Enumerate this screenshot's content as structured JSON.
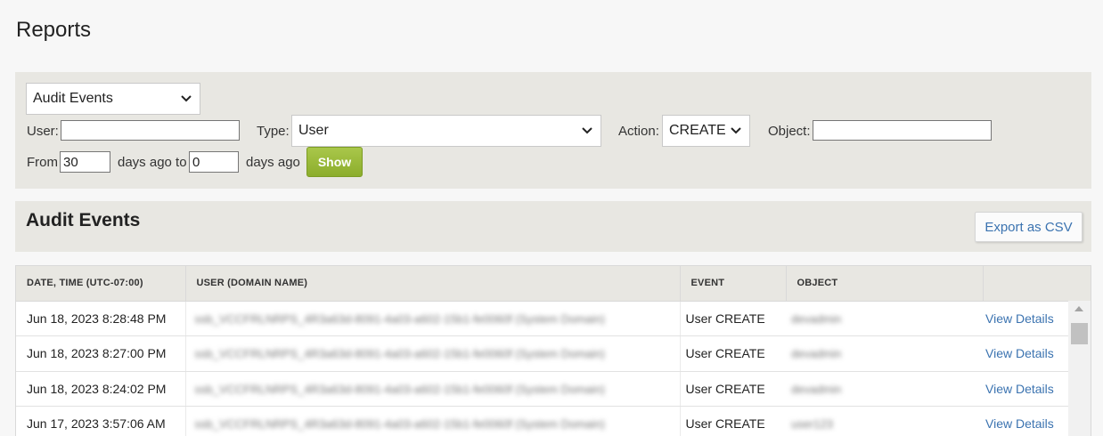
{
  "page": {
    "title": "Reports"
  },
  "filters": {
    "report_type": "Audit Events",
    "user_label": "User:",
    "user_value": "",
    "type_label": "Type:",
    "type_value": "User",
    "action_label": "Action:",
    "action_value": "CREATE",
    "object_label": "Object:",
    "object_value": "",
    "from_label": "From",
    "from_value": "30",
    "days_ago_to_label": "days ago to",
    "to_value": "0",
    "days_ago_label": "days ago",
    "show_label": "Show"
  },
  "events": {
    "title": "Audit Events",
    "export_label": "Export as CSV",
    "columns": [
      "DATE, TIME (UTC-07:00)",
      "USER (DOMAIN NAME)",
      "EVENT",
      "OBJECT",
      ""
    ],
    "rows": [
      {
        "datetime": "Jun 18, 2023 8:28:48 PM",
        "user": "ssb_VCCFRLNRPS_4R3a63d-8091-4a03-a602-15b1-fe0060f (System Domain)",
        "event": "User CREATE",
        "object": "devadmin",
        "action": "View Details"
      },
      {
        "datetime": "Jun 18, 2023 8:27:00 PM",
        "user": "ssb_VCCFRLNRPS_4R3a63d-8091-4a03-a602-15b1-fe0060f (System Domain)",
        "event": "User CREATE",
        "object": "devadmin",
        "action": "View Details"
      },
      {
        "datetime": "Jun 18, 2023 8:24:02 PM",
        "user": "ssb_VCCFRLNRPS_4R3a63d-8091-4a03-a602-15b1-fe0060f (System Domain)",
        "event": "User CREATE",
        "object": "devadmin",
        "action": "View Details"
      },
      {
        "datetime": "Jun 17, 2023 3:57:06 AM",
        "user": "ssb_VCCFRLNRPS_4R3a63d-8091-4a03-a602-15b1-fe0060f (System Domain)",
        "event": "User CREATE",
        "object": "user123",
        "action": "View Details"
      }
    ]
  },
  "icons": {
    "chevron": "chevron-down-icon",
    "scroll_up": "scroll-up-arrow-icon"
  },
  "colors": {
    "panel_bg": "#e8e7e2",
    "link": "#3b73b0",
    "show_button": "#9bbb3a"
  }
}
